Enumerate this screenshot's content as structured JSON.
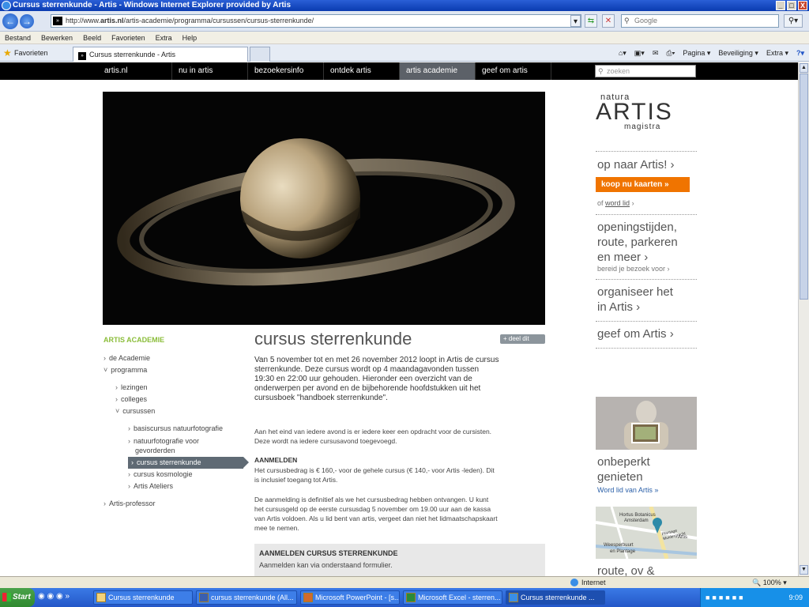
{
  "window": {
    "title": "Cursus sterrenkunde - Artis - Windows Internet Explorer provided by Artis",
    "min": "_",
    "max": "□",
    "close": "X"
  },
  "browser": {
    "url_prefix": "http://www.",
    "url_domain": "artis.nl",
    "url_path": "/artis-academie/programma/cursussen/cursus-sterrenkunde/",
    "search_placeholder": "Google",
    "menu": [
      "Bestand",
      "Bewerken",
      "Beeld",
      "Favorieten",
      "Extra",
      "Help"
    ],
    "favorites_label": "Favorieten",
    "tab_title": "Cursus sterrenkunde - Artis",
    "commands": [
      "Pagina ▾",
      "Beveiliging ▾",
      "Extra ▾"
    ]
  },
  "site": {
    "nav": [
      "artis.nl",
      "nu in artis",
      "bezoekersinfo",
      "ontdek artis",
      "artis academie",
      "geef om artis"
    ],
    "search_placeholder": "zoeken",
    "logo": {
      "top": "natura",
      "main": "ARTIS",
      "bottom": "magistra"
    },
    "right": {
      "op_naar": "op naar Artis! ›",
      "koop": "koop nu kaarten »",
      "of": "of",
      "word_lid": "word lid",
      "word_lid_arrow": "›",
      "openingstijden": [
        "openingstijden,",
        "route, parkeren",
        "en meer ›"
      ],
      "bereid": "bereid je bezoek voor ›",
      "organiseer": [
        "organiseer het",
        "in Artis ›"
      ],
      "geef": "geef om Artis ›",
      "onbeperkt": [
        "onbeperkt",
        "genieten"
      ],
      "word_lid_van": "Word lid van Artis »",
      "route": "route, ov &",
      "map_labels": [
        "Hortus Botanicus",
        "Amsterdam",
        "Artis",
        "Plantage Muidergracht",
        "Weesperbuurt",
        "en Plantage"
      ]
    },
    "leftnav": {
      "heading": "ARTIS ACADEMIE",
      "items": [
        {
          "label": "de Academie",
          "chev": "›"
        },
        {
          "label": "programma",
          "chev": "˅"
        },
        {
          "label": "lezingen",
          "chev": "›"
        },
        {
          "label": "colleges",
          "chev": "›"
        },
        {
          "label": "cursussen",
          "chev": "˅"
        },
        {
          "label": "basiscursus natuurfotografie",
          "chev": "›"
        },
        {
          "label": "natuurfotografie voor",
          "label2": "gevorderden",
          "chev": "›"
        },
        {
          "label": "cursus sterrenkunde",
          "chev": "›"
        },
        {
          "label": "cursus kosmologie",
          "chev": "›"
        },
        {
          "label": "Artis Ateliers",
          "chev": "›"
        },
        {
          "label": "Artis-professor",
          "chev": "›"
        }
      ]
    },
    "main": {
      "title": "cursus sterrenkunde",
      "deel": "+ deel dit",
      "intro": "Van 5 november tot en met 26 november 2012 loopt in Artis de cursus sterrenkunde. Deze cursus wordt op 4 maandagavonden tussen 19:30 en 22:00 uur gehouden. Hieronder een overzicht van de onderwerpen per avond en de bijbehorende hoofdstukken uit het cursusboek \"handboek sterrenkunde\".",
      "p1": "Aan het eind van iedere avond is er iedere keer een opdracht voor de cursisten. Deze wordt na iedere cursusavond toegevoegd.",
      "aanmelden_head": "AANMELDEN",
      "p2": "Het cursusbedrag  is € 160,- voor de gehele cursus (€ 140,- voor Artis -leden). Dit is inclusief toegang tot Artis.",
      "p3": "De aanmelding is definitief als we het cursusbedrag hebben ontvangen. U kunt het cursusgeld op de eerste cursusdag 5 november om 19.00 uur aan de kassa van Artis voldoen. Als u lid bent van artis, vergeet dan niet het lidmaatschapskaart mee te nemen.",
      "box_title": "AANMELDEN CURSUS STERRENKUNDE",
      "box_sub": "Aanmelden kan via onderstaand formulier."
    }
  },
  "status": {
    "zone": "Internet",
    "zoom": "🔍 100%  ▾"
  },
  "taskbar": {
    "start": "Start",
    "items": [
      "Cursus sterrenkunde",
      "cursus sterrenkunde (All...",
      "Microsoft PowerPoint - [s...",
      "Microsoft Excel - sterren...",
      "Cursus sterrenkunde ..."
    ],
    "clock": "9:09"
  },
  "colors": {
    "accent_orange": "#f07400",
    "academie_green": "#8bbd3a",
    "nav_active": "#5c6168"
  }
}
